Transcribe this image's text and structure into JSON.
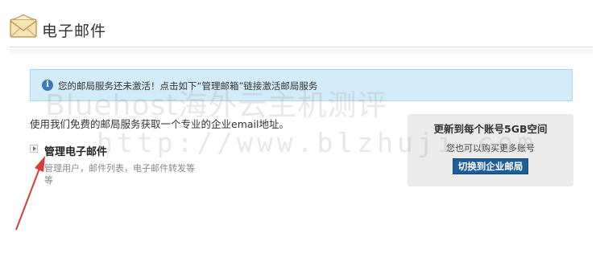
{
  "header": {
    "title": "电子邮件",
    "icon": "envelope-icon"
  },
  "notice": {
    "icon": "info-icon",
    "icon_glyph": "i",
    "text": "您的邮局服务还未激活！点击如下“管理邮箱”链接激活邮局服务"
  },
  "intro": "使用我们免费的邮局服务获取一个专业的企业email地址。",
  "manage": {
    "label": "管理电子邮件",
    "description": "管理用户，邮件列表，电子邮件转发等等"
  },
  "upsell": {
    "title": "更新到每个账号5GB空间",
    "subtitle": "您也可以购买更多账号",
    "button_label": "切换到企业邮局"
  },
  "watermark": {
    "line1": "Bluehost海外云主机测评",
    "line2": "http://www.blzhuji.com"
  },
  "colors": {
    "notice_bg": "#d2ecf9",
    "button_bg": "#1f5d99",
    "arrow": "#d93a3a"
  }
}
